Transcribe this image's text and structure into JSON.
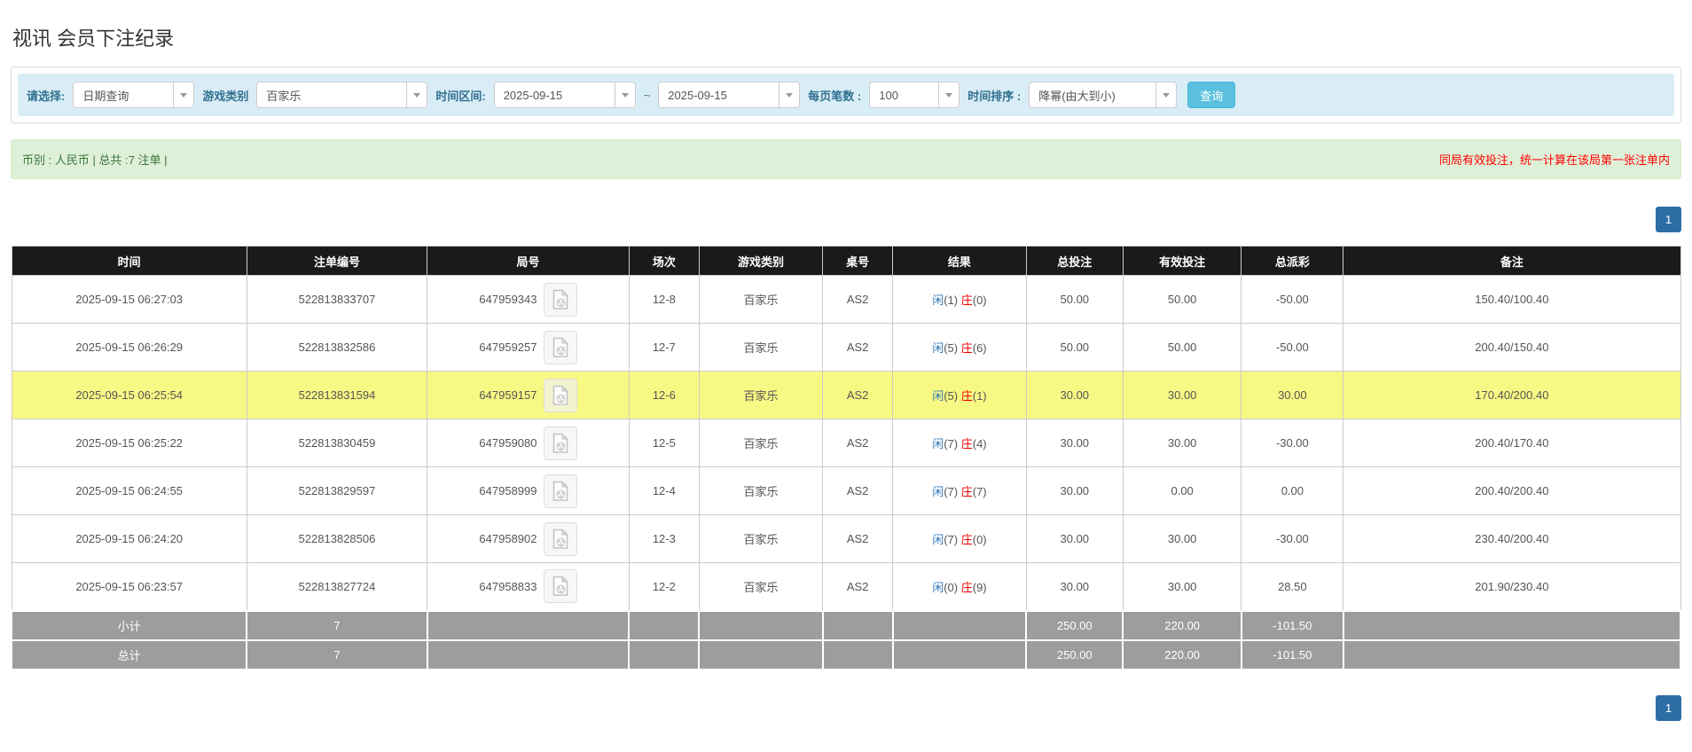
{
  "page_title": "视讯 会员下注纪录",
  "colors": {
    "accent_blue": "#337ab7",
    "negative_red": "#ee0000",
    "highlight_yellow": "#f8f885",
    "header_black": "#1a1a1a",
    "footer_grey": "#9d9d9d",
    "filter_bar_bg": "#d9edf7",
    "summary_bar_bg": "#dff0d8",
    "search_button_bg": "#5bc0de",
    "pager_bg": "#2e6da4"
  },
  "filters": {
    "select_label": "请选择:",
    "select_value": "日期查询",
    "game_label": "游戏类别",
    "game_value": "百家乐",
    "range_label": "时间区间:",
    "range_from": "2025-09-15",
    "range_separator": "~",
    "range_to": "2025-09-15",
    "per_page_label": "每页笔数 :",
    "per_page_value": "100",
    "sort_label": "时间排序 :",
    "sort_value": "降幂(由大到小)",
    "search_button": "查询"
  },
  "summary": {
    "currency_info": "币别 : 人民币 | 总共 :7 注单 |",
    "note": "同局有效投注，统一计算在该局第一张注单内"
  },
  "pagination": {
    "current_page": "1"
  },
  "table": {
    "columns": [
      "时间",
      "注单编号",
      "局号",
      "场次",
      "游戏类别",
      "桌号",
      "结果",
      "总投注",
      "有效投注",
      "总派彩",
      "备注"
    ],
    "rows": [
      {
        "time": "2025-09-15 06:27:03",
        "bet_id": "522813833707",
        "round_id": "647959343",
        "session": "12-8",
        "game": "百家乐",
        "table_no": "AS2",
        "result_p_label": "闲",
        "result_p": "(1)",
        "result_b_label": "庄",
        "result_b": "(0)",
        "total_bet": "50.00",
        "valid_bet": "50.00",
        "payout": "-50.00",
        "note": "150.40/100.40",
        "highlight": false
      },
      {
        "time": "2025-09-15 06:26:29",
        "bet_id": "522813832586",
        "round_id": "647959257",
        "session": "12-7",
        "game": "百家乐",
        "table_no": "AS2",
        "result_p_label": "闲",
        "result_p": "(5)",
        "result_b_label": "庄",
        "result_b": "(6)",
        "total_bet": "50.00",
        "valid_bet": "50.00",
        "payout": "-50.00",
        "note": "200.40/150.40",
        "highlight": false
      },
      {
        "time": "2025-09-15 06:25:54",
        "bet_id": "522813831594",
        "round_id": "647959157",
        "session": "12-6",
        "game": "百家乐",
        "table_no": "AS2",
        "result_p_label": "闲",
        "result_p": "(5)",
        "result_b_label": "庄",
        "result_b": "(1)",
        "total_bet": "30.00",
        "valid_bet": "30.00",
        "payout": "30.00",
        "note": "170.40/200.40",
        "highlight": true
      },
      {
        "time": "2025-09-15 06:25:22",
        "bet_id": "522813830459",
        "round_id": "647959080",
        "session": "12-5",
        "game": "百家乐",
        "table_no": "AS2",
        "result_p_label": "闲",
        "result_p": "(7)",
        "result_b_label": "庄",
        "result_b": "(4)",
        "total_bet": "30.00",
        "valid_bet": "30.00",
        "payout": "-30.00",
        "note": "200.40/170.40",
        "highlight": false
      },
      {
        "time": "2025-09-15 06:24:55",
        "bet_id": "522813829597",
        "round_id": "647958999",
        "session": "12-4",
        "game": "百家乐",
        "table_no": "AS2",
        "result_p_label": "闲",
        "result_p": "(7)",
        "result_b_label": "庄",
        "result_b": "(7)",
        "total_bet": "30.00",
        "valid_bet": "0.00",
        "payout": "0.00",
        "note": "200.40/200.40",
        "highlight": false
      },
      {
        "time": "2025-09-15 06:24:20",
        "bet_id": "522813828506",
        "round_id": "647958902",
        "session": "12-3",
        "game": "百家乐",
        "table_no": "AS2",
        "result_p_label": "闲",
        "result_p": "(7)",
        "result_b_label": "庄",
        "result_b": "(0)",
        "total_bet": "30.00",
        "valid_bet": "30.00",
        "payout": "-30.00",
        "note": "230.40/200.40",
        "highlight": false
      },
      {
        "time": "2025-09-15 06:23:57",
        "bet_id": "522813827724",
        "round_id": "647958833",
        "session": "12-2",
        "game": "百家乐",
        "table_no": "AS2",
        "result_p_label": "闲",
        "result_p": "(0)",
        "result_b_label": "庄",
        "result_b": "(9)",
        "total_bet": "30.00",
        "valid_bet": "30.00",
        "payout": "28.50",
        "note": "201.90/230.40",
        "highlight": false
      }
    ],
    "subtotal": {
      "label": "小计",
      "count": "7",
      "total_bet": "250.00",
      "valid_bet": "220.00",
      "payout": "-101.50"
    },
    "total": {
      "label": "总计",
      "count": "7",
      "total_bet": "250.00",
      "valid_bet": "220.00",
      "payout": "-101.50"
    }
  }
}
